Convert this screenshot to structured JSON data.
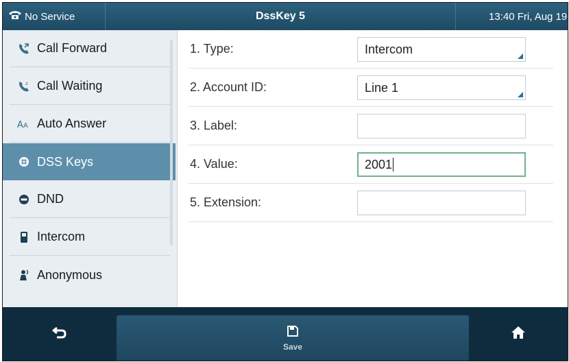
{
  "status_bar": {
    "service_status": "No Service",
    "title": "DssKey 5",
    "datetime": "13:40 Fri, Aug 19"
  },
  "sidebar": {
    "items": [
      {
        "label": "Call Forward",
        "icon": "call-forward-icon",
        "active": false
      },
      {
        "label": "Call Waiting",
        "icon": "call-waiting-icon",
        "active": false
      },
      {
        "label": "Auto Answer",
        "icon": "auto-answer-icon",
        "active": false
      },
      {
        "label": "DSS Keys",
        "icon": "dss-keys-icon",
        "active": true
      },
      {
        "label": "DND",
        "icon": "dnd-icon",
        "active": false
      },
      {
        "label": "Intercom",
        "icon": "intercom-icon",
        "active": false
      },
      {
        "label": "Anonymous",
        "icon": "anonymous-icon",
        "active": false
      }
    ]
  },
  "form": {
    "rows": [
      {
        "label": "1. Type:",
        "value": "Intercom",
        "type": "combo"
      },
      {
        "label": "2. Account ID:",
        "value": "Line 1",
        "type": "combo"
      },
      {
        "label": "3. Label:",
        "value": "",
        "type": "text"
      },
      {
        "label": "4. Value:",
        "value": "2001",
        "type": "text",
        "focused": true
      },
      {
        "label": "5. Extension:",
        "value": "",
        "type": "text"
      }
    ]
  },
  "bottom_bar": {
    "back_icon": "back-arrow-icon",
    "save_label": "Save",
    "save_icon": "save-icon",
    "home_icon": "home-icon"
  },
  "colors": {
    "status_bar": "#245673",
    "active_item": "#5d8fab",
    "focus_border": "#6fb18c",
    "combo_arrow": "#2f6f93"
  }
}
